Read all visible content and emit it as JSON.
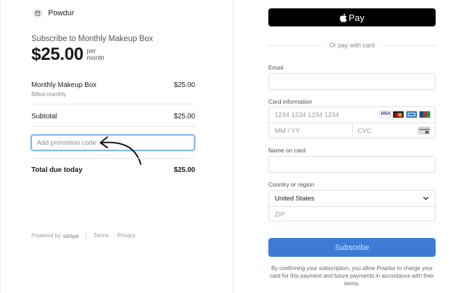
{
  "brand": {
    "name": "Powdur"
  },
  "summary": {
    "subtitle": "Subscribe to Monthly Makeup Box",
    "price": "$25.00",
    "period": "per month"
  },
  "line_item": {
    "name": "Monthly Makeup Box",
    "billing": "Billed monthly",
    "amount": "$25.00"
  },
  "subtotal": {
    "label": "Subtotal",
    "amount": "$25.00"
  },
  "promo": {
    "placeholder": "Add promotion code"
  },
  "total": {
    "label": "Total due today",
    "amount": "$25.00"
  },
  "footer": {
    "powered_by": "Powered by",
    "stripe": "stripe",
    "terms": "Terms",
    "privacy": "Privacy"
  },
  "payment": {
    "apple_pay": "Pay",
    "or_text": "Or pay with card",
    "email_label": "Email",
    "email_value": "",
    "card_label": "Card information",
    "card_number_placeholder": "1234 1234 1234 1234",
    "card_brands": [
      "visa-icon",
      "mastercard-icon",
      "amex-icon",
      "jcb-icon"
    ],
    "expiry_placeholder": "MM / YY",
    "cvc_placeholder": "CVC",
    "name_label": "Name on card",
    "name_value": "",
    "country_label": "Country or region",
    "country_value": "United States",
    "zip_placeholder": "ZIP",
    "subscribe_label": "Subscribe",
    "legal_text": "By confirming your subscription, you allow Powdur to charge your card for this payment and future payments in accordance with their terms."
  },
  "colors": {
    "subscribe_button": "#3e7bd4",
    "apple_pay_button": "#000000",
    "promo_focus_border": "#8ab8e6"
  }
}
